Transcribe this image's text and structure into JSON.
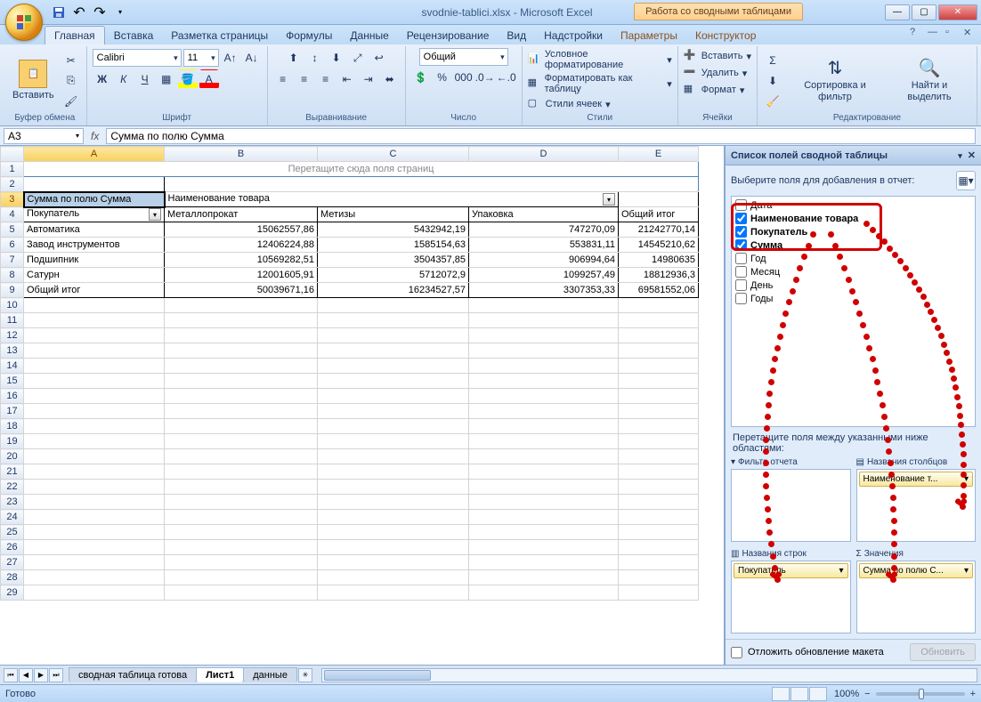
{
  "title": "svodnie-tablici.xlsx - Microsoft Excel",
  "contextual_tab": "Работа со сводными таблицами",
  "tabs": [
    "Главная",
    "Вставка",
    "Разметка страницы",
    "Формулы",
    "Данные",
    "Рецензирование",
    "Вид",
    "Надстройки",
    "Параметры",
    "Конструктор"
  ],
  "active_tab": 0,
  "ribbon": {
    "clipboard": {
      "paste": "Вставить",
      "label": "Буфер обмена"
    },
    "font": {
      "name": "Calibri",
      "size": "11",
      "label": "Шрифт"
    },
    "align": {
      "label": "Выравнивание"
    },
    "number": {
      "format": "Общий",
      "label": "Число"
    },
    "styles": {
      "cond": "Условное форматирование",
      "table": "Форматировать как таблицу",
      "cell": "Стили ячеек",
      "label": "Стили"
    },
    "cells": {
      "insert": "Вставить",
      "delete": "Удалить",
      "format": "Формат",
      "label": "Ячейки"
    },
    "editing": {
      "sort": "Сортировка и фильтр",
      "find": "Найти и выделить",
      "label": "Редактирование"
    }
  },
  "name_box": "A3",
  "formula": "Сумма по полю Сумма",
  "columns": [
    "A",
    "B",
    "C",
    "D",
    "E"
  ],
  "page_filter_text": "Перетащите сюда поля страниц",
  "pivot": {
    "data_label": "Сумма по полю Сумма",
    "col_field": "Наименование товара",
    "row_field": "Покупатель",
    "col_headers": [
      "Металлопрокат",
      "Метизы",
      "Упаковка",
      "Общий итог"
    ],
    "rows": [
      {
        "label": "Автоматика",
        "v": [
          "15062557,86",
          "5432942,19",
          "747270,09",
          "21242770,14"
        ]
      },
      {
        "label": "Завод инструментов",
        "v": [
          "12406224,88",
          "1585154,63",
          "553831,11",
          "14545210,62"
        ]
      },
      {
        "label": "Подшипник",
        "v": [
          "10569282,51",
          "3504357,85",
          "906994,64",
          "14980635"
        ]
      },
      {
        "label": "Сатурн",
        "v": [
          "12001605,91",
          "5712072,9",
          "1099257,49",
          "18812936,3"
        ]
      },
      {
        "label": "Общий итог",
        "v": [
          "50039671,16",
          "16234527,57",
          "3307353,33",
          "69581552,06"
        ]
      }
    ]
  },
  "pane": {
    "title": "Список полей сводной таблицы",
    "choose": "Выберите поля для добавления в отчет:",
    "fields": [
      {
        "name": "Дата",
        "checked": false,
        "bold": false
      },
      {
        "name": "Наименование товара",
        "checked": true,
        "bold": true
      },
      {
        "name": "Покупатель",
        "checked": true,
        "bold": true
      },
      {
        "name": "Сумма",
        "checked": true,
        "bold": true
      },
      {
        "name": "Год",
        "checked": false,
        "bold": false
      },
      {
        "name": "Месяц",
        "checked": false,
        "bold": false
      },
      {
        "name": "День",
        "checked": false,
        "bold": false
      },
      {
        "name": "Годы",
        "checked": false,
        "bold": false
      }
    ],
    "drag": "Перетащите поля между указанными ниже областями:",
    "areas": {
      "filter": "Фильтр отчета",
      "cols": "Названия столбцов",
      "rows": "Названия строк",
      "vals": "Значения",
      "col_item": "Наименование т...",
      "row_item": "Покупатель",
      "val_item": "Сумма по полю С..."
    },
    "defer": "Отложить обновление макета",
    "update": "Обновить"
  },
  "sheets": [
    "сводная таблица готова",
    "Лист1",
    "данные"
  ],
  "active_sheet": 1,
  "status": "Готово",
  "zoom": "100%"
}
